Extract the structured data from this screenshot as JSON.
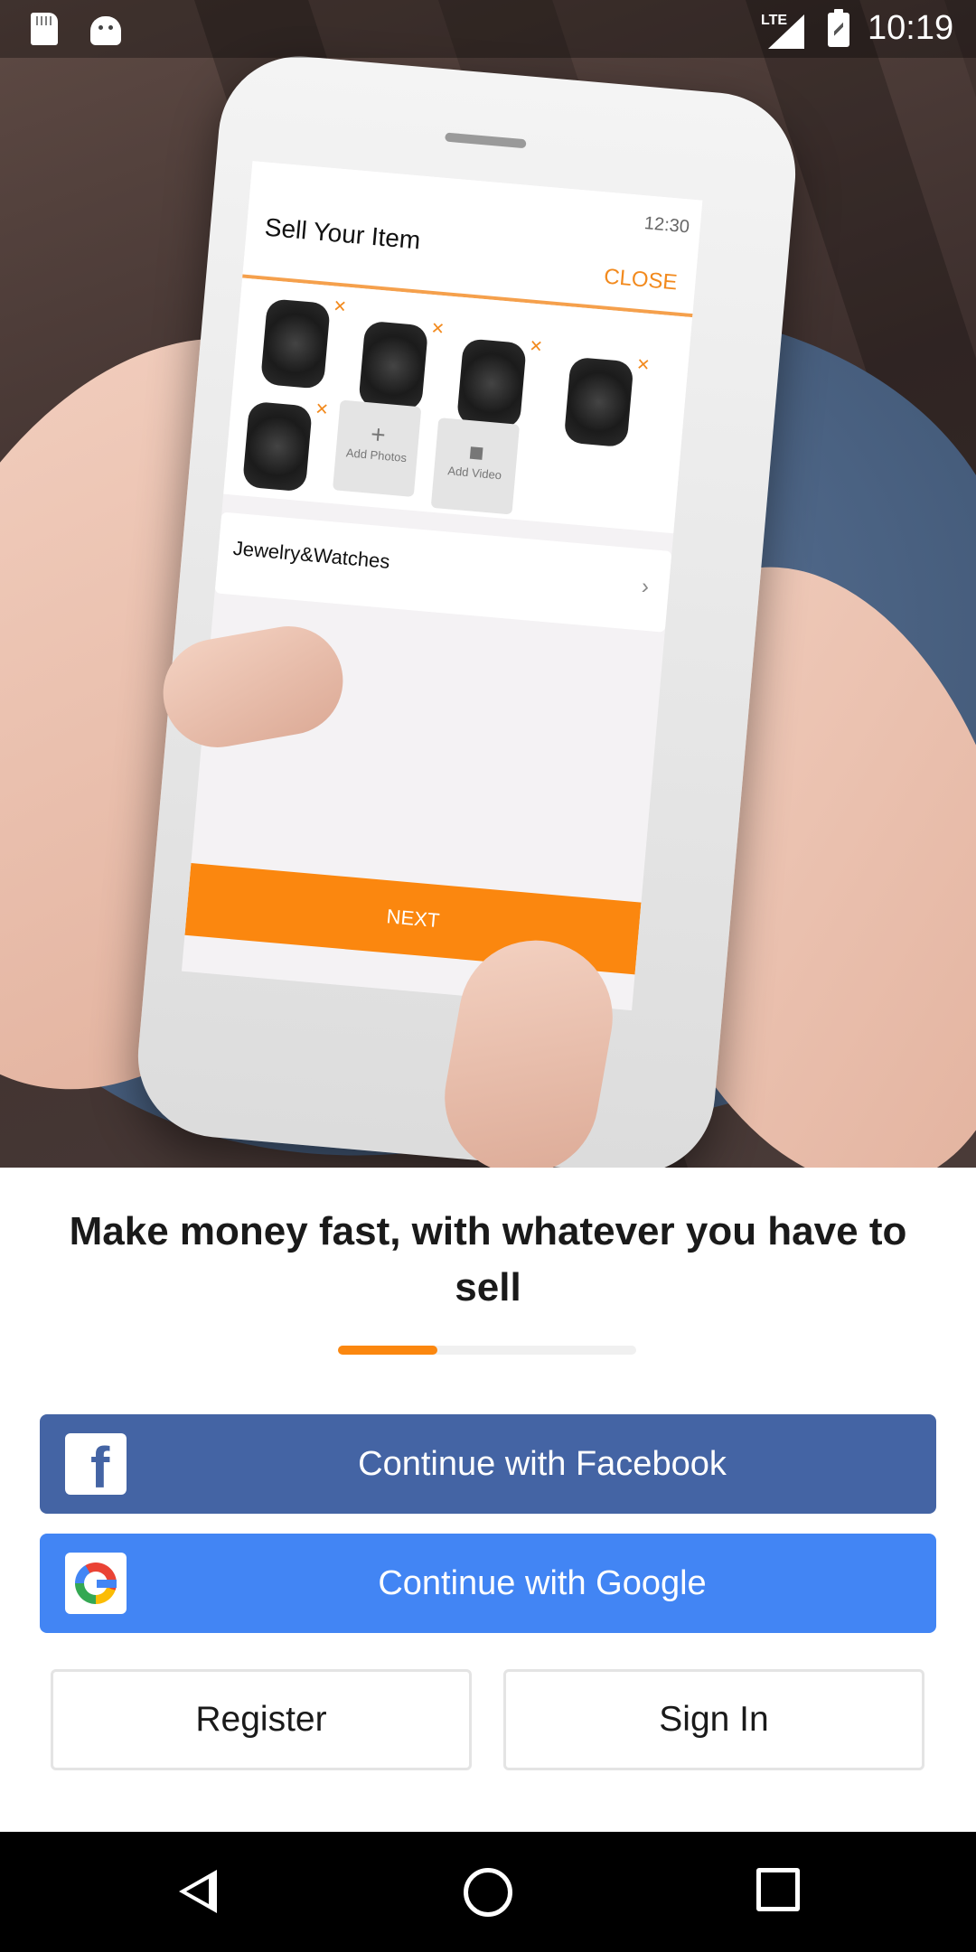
{
  "status_bar": {
    "time": "10:19",
    "network": "LTE",
    "icons": [
      "sd-card-icon",
      "android-debug-icon",
      "lte-signal-icon",
      "battery-charging-icon"
    ]
  },
  "hero": {
    "phone_screen": {
      "title": "Sell Your Item",
      "time": "12:30",
      "close_label": "CLOSE",
      "add_photos_label": "Add Photos",
      "add_video_label": "Add Video",
      "category": "Jewelry&Watches",
      "next_label": "NEXT"
    }
  },
  "headline": "Make money fast, with whatever you have to sell",
  "pager": {
    "current_page": 1,
    "total_pages": 3,
    "progress_fraction": 0.333
  },
  "buttons": {
    "facebook": "Continue with Facebook",
    "google": "Continue with Google",
    "register": "Register",
    "sign_in": "Sign In"
  },
  "colors": {
    "accent": "#fb870f",
    "facebook": "#4464a4",
    "google": "#4285f4",
    "text": "#1a1a1a"
  },
  "nav_bar": {
    "icons": [
      "back-icon",
      "home-icon",
      "recents-icon"
    ]
  }
}
